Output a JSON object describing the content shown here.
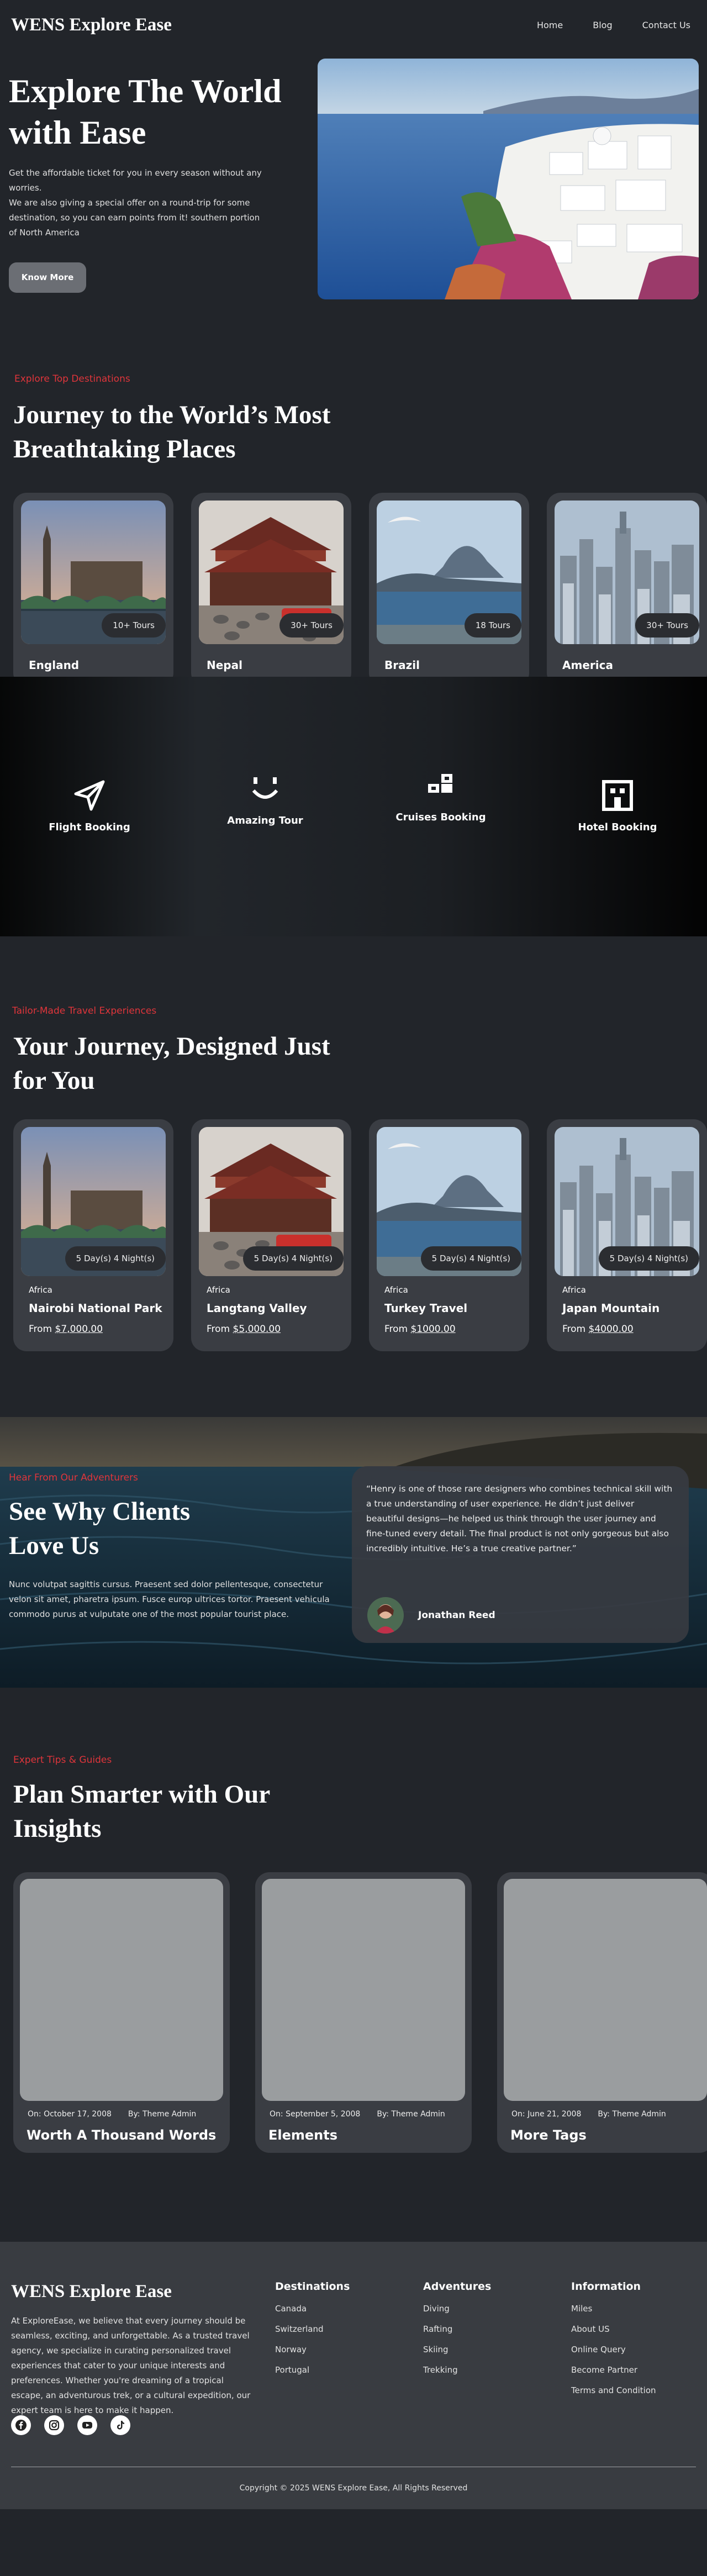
{
  "header": {
    "brand": "WENS Explore Ease",
    "nav": [
      "Home",
      "Blog",
      "Contact Us"
    ]
  },
  "hero": {
    "title": "Explore The World with Ease",
    "text_1": "Get the affordable ticket for you in every season without any worries.",
    "text_2": "We are also giving a special offer on a round-trip for some destination, so you can earn points from it! southern portion of North America",
    "button": "Know More"
  },
  "destinations": {
    "kicker": "Explore Top Destinations",
    "title": "Journey to the World’s Most Breathtaking Places",
    "cards": [
      {
        "name": "England",
        "tours": "10+ Tours"
      },
      {
        "name": "Nepal",
        "tours": "30+ Tours"
      },
      {
        "name": "Brazil",
        "tours": "18 Tours"
      },
      {
        "name": "America",
        "tours": "30+ Tours"
      }
    ]
  },
  "services": [
    {
      "label": "Flight Booking",
      "icon": "paper-plane-icon"
    },
    {
      "label": "Amazing Tour",
      "icon": "smile-icon"
    },
    {
      "label": "Cruises Booking",
      "icon": "blocks-icon"
    },
    {
      "label": "Hotel Booking",
      "icon": "hotel-icon"
    }
  ],
  "experiences": {
    "kicker": "Tailor-Made Travel Experiences",
    "title": "Your Journey, Designed Just for You",
    "from_label": "From",
    "cards": [
      {
        "region": "Africa",
        "name": "Nairobi National Park",
        "price": "$7,000.00",
        "duration": "5 Day(s) 4 Night(s)"
      },
      {
        "region": "Africa",
        "name": "Langtang Valley",
        "price": "$5,000.00",
        "duration": "5 Day(s) 4 Night(s)"
      },
      {
        "region": "Africa",
        "name": "Turkey Travel",
        "price": "$1000.00",
        "duration": "5 Day(s) 4 Night(s)"
      },
      {
        "region": "Africa",
        "name": "Japan Mountain",
        "price": "$4000.00",
        "duration": "5 Day(s) 4 Night(s)"
      }
    ]
  },
  "testimonials": {
    "kicker": "Hear From Our Adventurers",
    "title": "See Why Clients Love Us",
    "text": "Nunc volutpat sagittis cursus. Praesent sed dolor pellentesque, consectetur velon sit amet, pharetra ipsum. Fusce europ ultrices tortor. Praesent vehicula commodo purus at vulputate one of the most popular tourist place.",
    "quote": "“Henry is one of those rare designers who combines technical skill with a true understanding of user experience. He didn’t just deliver beautiful designs—he helped us think through the user journey and fine-tuned every detail. The final product is not only gorgeous but also incredibly intuitive. He’s a true creative partner.”",
    "author": "Jonathan Reed"
  },
  "blog": {
    "kicker": "Expert Tips & Guides",
    "title": "Plan Smarter with Our Insights",
    "on_label": "On:",
    "by_label": "By:",
    "posts": [
      {
        "date": "October 17, 2008",
        "author": "Theme Admin",
        "title": "Worth A Thousand Words"
      },
      {
        "date": "September 5, 2008",
        "author": "Theme Admin",
        "title": "Elements"
      },
      {
        "date": "June 21, 2008",
        "author": "Theme Admin",
        "title": "More Tags"
      }
    ]
  },
  "footer": {
    "brand": "WENS Explore Ease",
    "about": "At ExploreEase, we believe that every journey should be seamless, exciting, and unforgettable. As a trusted travel agency, we specialize in curating personalized travel experiences that cater to your unique interests and preferences. Whether you're dreaming of a tropical escape, an adventurous trek, or a cultural expedition, our expert team is here to make it happen.",
    "columns": [
      {
        "title": "Destinations",
        "items": [
          "Canada",
          "Switzerland",
          "Norway",
          "Portugal"
        ]
      },
      {
        "title": "Adventures",
        "items": [
          "Diving",
          "Rafting",
          "Skiing",
          "Trekking"
        ]
      },
      {
        "title": "Information",
        "items": [
          "Miles",
          "About US",
          "Online Query",
          "Become Partner",
          "Terms and Condition"
        ]
      }
    ],
    "socials": [
      "facebook-icon",
      "instagram-icon",
      "youtube-icon",
      "tiktok-icon"
    ],
    "copyright": "Copyright © 2025 WENS Explore Ease, All Rights Reserved"
  }
}
